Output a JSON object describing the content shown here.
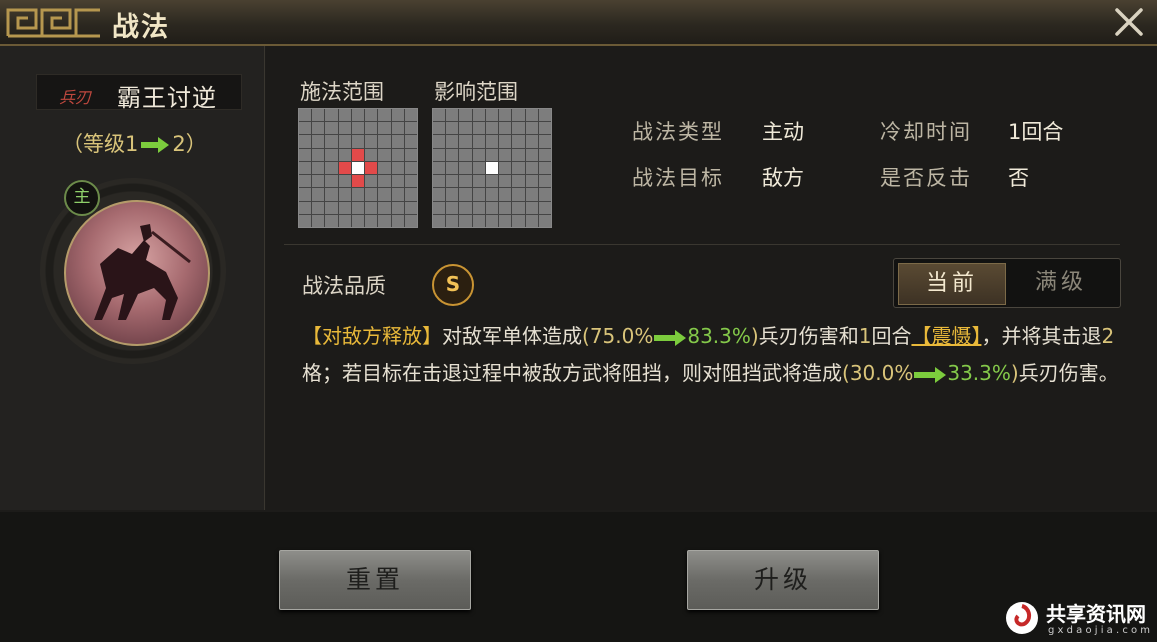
{
  "window": {
    "title": "战法",
    "close_icon": "close-icon"
  },
  "skill": {
    "type_label": "兵刃",
    "name": "霸王讨逆",
    "level_prefix": "（等级1",
    "level_suffix": "2）",
    "main_badge": "主",
    "portrait": "general-on-horse-portrait"
  },
  "ranges": {
    "cast_label": "施法范围",
    "effect_label": "影响范围",
    "cast_hits": [
      [
        3,
        4
      ],
      [
        4,
        3
      ],
      [
        4,
        5
      ],
      [
        5,
        4
      ]
    ],
    "cast_center": [
      4,
      4
    ],
    "effect_center": [
      4,
      4
    ]
  },
  "info": {
    "type_label": "战法类型",
    "type_value": "主动",
    "cooldown_label": "冷却时间",
    "cooldown_value": "1回合",
    "target_label": "战法目标",
    "target_value": "敌方",
    "counter_label": "是否反击",
    "counter_value": "否"
  },
  "quality": {
    "label": "战法品质",
    "grade": "S"
  },
  "toggle": {
    "current": "当前",
    "max": "满级"
  },
  "description": {
    "kw1": "【对敌方释放】",
    "t1": "对敌军单体造成",
    "p1": "(",
    "v1_old": "75.0%",
    "v1_new": "83.3%",
    "p2": ")",
    "t2": "兵刃伤害和",
    "n1": "1",
    "t3": "回合",
    "kw2": "【震慑】",
    "t4": "，并将其击退",
    "n2": "2",
    "t5": "格；若目标在击退过程中被敌方武将阻挡，则对阻挡武将造成",
    "p3": "(",
    "v2_old": "30.0%",
    "v2_new": "33.3%",
    "p4": ")",
    "t6": "兵刃伤害。"
  },
  "buttons": {
    "reset": "重置",
    "upgrade": "升级"
  },
  "watermark": {
    "text": "共享资讯网",
    "sub": "g x d a o j i a . c o m"
  },
  "colors": {
    "accent_gold": "#e9b93a",
    "upgrade_green": "#84c94a",
    "hit_red": "#e24a4a"
  }
}
